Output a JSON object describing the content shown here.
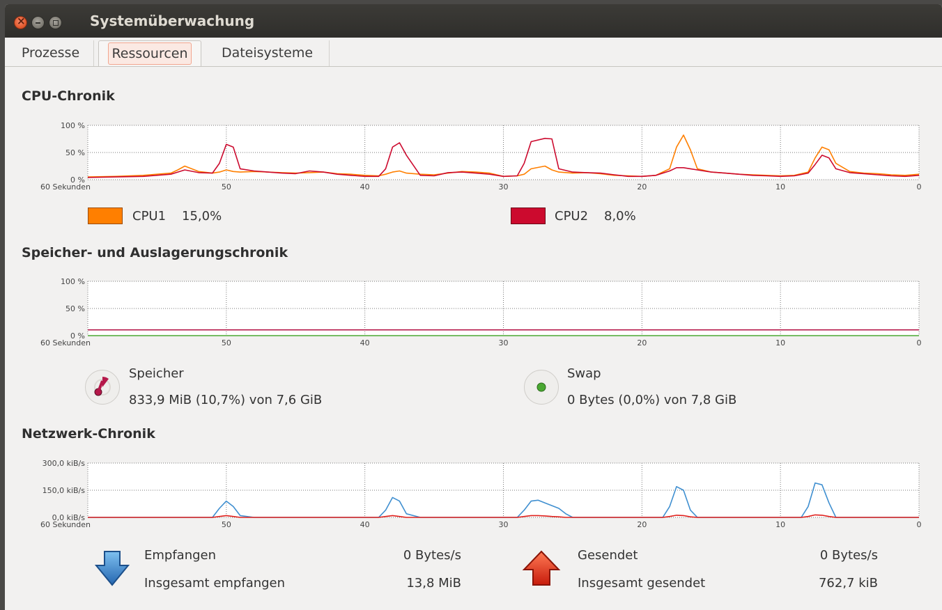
{
  "window": {
    "title": "Systemüberwachung"
  },
  "tabs": [
    {
      "label": "Prozesse",
      "active": false
    },
    {
      "label": "Ressourcen",
      "active": true
    },
    {
      "label": "Dateisysteme",
      "active": false
    }
  ],
  "cpu": {
    "title": "CPU-Chronik",
    "y_ticks": [
      "100 %",
      "50 %",
      "0 %"
    ],
    "x_ticks": [
      "60 Sekunden",
      "50",
      "40",
      "30",
      "20",
      "10",
      "0"
    ],
    "legend": [
      {
        "name": "CPU1",
        "value": "15,0%",
        "color": "#ff7f00"
      },
      {
        "name": "CPU2",
        "value": "8,0%",
        "color": "#cc0a2e"
      }
    ]
  },
  "memory": {
    "title": "Speicher- und Auslagerungschronik",
    "y_ticks": [
      "100 %",
      "50 %",
      "0 %"
    ],
    "x_ticks": [
      "60 Sekunden",
      "50",
      "40",
      "30",
      "20",
      "10",
      "0"
    ],
    "speicher": {
      "label": "Speicher",
      "value": "833,9 MiB (10,7%) von 7,6 GiB",
      "color": "#b5184a",
      "percent": 10.7
    },
    "swap": {
      "label": "Swap",
      "value": "0 Bytes (0,0%) von 7,8 GiB",
      "color": "#4aa832",
      "percent": 0.0
    }
  },
  "network": {
    "title": "Netzwerk-Chronik",
    "y_ticks": [
      "300,0 kiB/s",
      "150,0 kiB/s",
      "0,0 kiB/s"
    ],
    "x_ticks": [
      "60 Sekunden",
      "50",
      "40",
      "30",
      "20",
      "10",
      "0"
    ],
    "received_label": "Empfangen",
    "received_value": "0 Bytes/s",
    "total_received_label": "Insgesamt empfangen",
    "total_received_value": "13,8 MiB",
    "sent_label": "Gesendet",
    "sent_value": "0 Bytes/s",
    "total_sent_label": "Insgesamt gesendet",
    "total_sent_value": "762,7 kiB"
  },
  "chart_data": [
    {
      "type": "line",
      "title": "CPU-Chronik",
      "xlabel": "",
      "ylabel": "",
      "x_range": [
        60,
        0
      ],
      "ylim": [
        0,
        100
      ],
      "x": [
        60,
        58,
        56,
        54,
        53.5,
        53,
        52,
        51,
        50.5,
        50,
        49.5,
        49,
        48,
        46,
        45,
        44,
        43,
        42,
        41,
        40,
        39,
        38.5,
        38,
        37.5,
        37,
        36,
        35,
        34,
        33,
        32,
        31,
        30,
        29,
        28.5,
        28,
        27,
        26.5,
        26,
        25,
        24,
        23,
        22,
        21,
        20,
        19,
        18,
        17.5,
        17,
        16.5,
        16,
        15,
        14,
        13,
        12,
        11,
        10,
        9,
        8,
        7.5,
        7,
        6.5,
        6,
        5,
        4,
        3,
        2,
        1,
        0
      ],
      "series": [
        {
          "name": "CPU1",
          "color": "#ff7f00",
          "values": [
            5,
            6,
            8,
            12,
            18,
            25,
            15,
            12,
            14,
            18,
            15,
            14,
            15,
            13,
            12,
            13,
            14,
            11,
            10,
            8,
            7,
            10,
            14,
            16,
            12,
            10,
            9,
            12,
            15,
            14,
            12,
            6,
            7,
            10,
            20,
            25,
            18,
            14,
            12,
            13,
            11,
            8,
            7,
            6,
            8,
            20,
            60,
            82,
            55,
            20,
            14,
            12,
            10,
            9,
            8,
            7,
            8,
            14,
            40,
            60,
            55,
            30,
            15,
            12,
            11,
            9,
            8,
            10
          ]
        },
        {
          "name": "CPU2",
          "color": "#cc0a2e",
          "values": [
            4,
            5,
            6,
            10,
            14,
            18,
            13,
            12,
            30,
            65,
            60,
            20,
            16,
            12,
            11,
            16,
            14,
            10,
            8,
            6,
            6,
            20,
            60,
            68,
            45,
            8,
            7,
            13,
            14,
            12,
            10,
            6,
            7,
            30,
            70,
            76,
            75,
            20,
            14,
            13,
            12,
            9,
            6,
            6,
            8,
            16,
            22,
            22,
            20,
            18,
            14,
            12,
            10,
            8,
            7,
            6,
            7,
            12,
            28,
            45,
            40,
            20,
            13,
            11,
            9,
            7,
            6,
            8
          ]
        }
      ]
    },
    {
      "type": "line",
      "title": "Speicher- und Auslagerungschronik",
      "xlabel": "",
      "ylabel": "",
      "x_range": [
        60,
        0
      ],
      "ylim": [
        0,
        100
      ],
      "x": [
        60,
        0
      ],
      "series": [
        {
          "name": "Speicher",
          "color": "#b5184a",
          "values": [
            10.7,
            10.7
          ]
        },
        {
          "name": "Swap",
          "color": "#4aa832",
          "values": [
            0.0,
            0.0
          ]
        }
      ]
    },
    {
      "type": "line",
      "title": "Netzwerk-Chronik",
      "xlabel": "",
      "ylabel": "kiB/s",
      "x_range": [
        60,
        0
      ],
      "ylim": [
        0,
        300
      ],
      "x": [
        60,
        52,
        51,
        50.5,
        50,
        49.5,
        49,
        48,
        39,
        38.5,
        38,
        37.5,
        37,
        36,
        30,
        29,
        28.5,
        28,
        27.5,
        27,
        26.5,
        26,
        25.5,
        25,
        19,
        18.5,
        18,
        17.5,
        17,
        16.5,
        16,
        9,
        8.5,
        8,
        7.5,
        7,
        6.5,
        6,
        0
      ],
      "series": [
        {
          "name": "Empfangen",
          "color": "#3f8fd0",
          "values": [
            0,
            0,
            0,
            50,
            90,
            60,
            10,
            0,
            0,
            40,
            110,
            90,
            20,
            0,
            0,
            0,
            40,
            90,
            95,
            80,
            65,
            50,
            20,
            0,
            0,
            0,
            60,
            170,
            150,
            40,
            0,
            0,
            0,
            60,
            190,
            180,
            80,
            0,
            0
          ]
        },
        {
          "name": "Gesendet",
          "color": "#e0201c",
          "values": [
            0,
            0,
            0,
            5,
            10,
            5,
            0,
            0,
            0,
            5,
            10,
            5,
            0,
            0,
            0,
            0,
            5,
            10,
            10,
            8,
            5,
            3,
            0,
            0,
            0,
            0,
            5,
            12,
            10,
            3,
            0,
            0,
            0,
            5,
            14,
            12,
            5,
            0,
            0
          ]
        }
      ]
    }
  ]
}
